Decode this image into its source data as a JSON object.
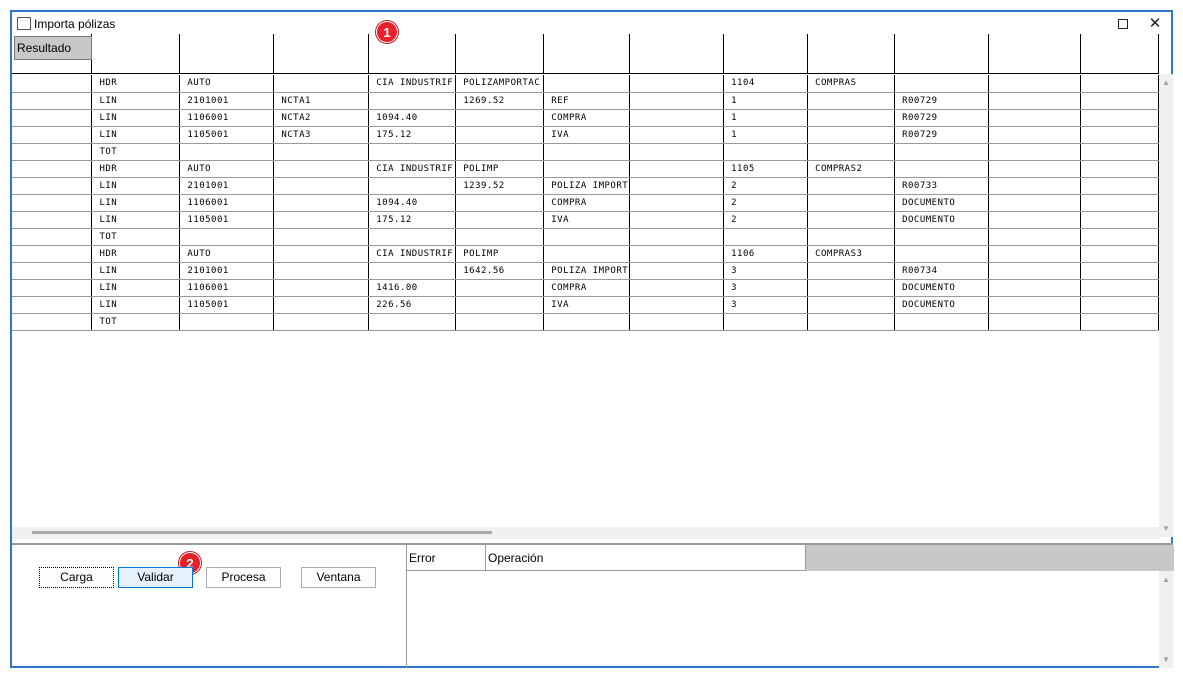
{
  "window": {
    "title": "Importa pólizas",
    "maximize_glyph": "□",
    "close_glyph": "✕"
  },
  "annotations": {
    "badge1": "1",
    "badge2": "2"
  },
  "grid": {
    "header_label": "Resultado",
    "columns": 12,
    "rows": [
      [
        "",
        "HDR",
        "AUTO",
        "",
        "CIA INDUSTRIF",
        "POLIZAMPORTAC",
        "",
        "",
        "1104",
        "COMPRAS",
        "",
        "",
        ""
      ],
      [
        "",
        "LIN",
        "2101001",
        "NCTA1",
        "",
        "1269.52",
        "REF",
        "",
        "1",
        "",
        "R00729",
        "",
        ""
      ],
      [
        "",
        "LIN",
        "1106001",
        "NCTA2",
        "1094.40",
        "",
        "COMPRA",
        "",
        "1",
        "",
        "R00729",
        "",
        ""
      ],
      [
        "",
        "LIN",
        "1105001",
        "NCTA3",
        "175.12",
        "",
        "IVA",
        "",
        "1",
        "",
        "R00729",
        "",
        ""
      ],
      [
        "",
        "TOT",
        "",
        "",
        "",
        "",
        "",
        "",
        "",
        "",
        "",
        "",
        ""
      ],
      [
        "",
        "HDR",
        "AUTO",
        "",
        "CIA INDUSTRIF",
        "POLIMP",
        "",
        "",
        "1105",
        "COMPRAS2",
        "",
        "",
        ""
      ],
      [
        "",
        "LIN",
        "2101001",
        "",
        "",
        "1239.52",
        "POLIZA IMPORT",
        "",
        "2",
        "",
        "R00733",
        "",
        ""
      ],
      [
        "",
        "LIN",
        "1106001",
        "",
        "1094.40",
        "",
        "COMPRA",
        "",
        "2",
        "",
        "DOCUMENTO",
        "",
        ""
      ],
      [
        "",
        "LIN",
        "1105001",
        "",
        "175.12",
        "",
        "IVA",
        "",
        "2",
        "",
        "DOCUMENTO",
        "",
        ""
      ],
      [
        "",
        "TOT",
        "",
        "",
        "",
        "",
        "",
        "",
        "",
        "",
        "",
        "",
        ""
      ],
      [
        "",
        "HDR",
        "AUTO",
        "",
        "CIA INDUSTRIF",
        "POLIMP",
        "",
        "",
        "1106",
        "COMPRAS3",
        "",
        "",
        ""
      ],
      [
        "",
        "LIN",
        "2101001",
        "",
        "",
        "1642.56",
        "POLIZA IMPORT",
        "",
        "3",
        "",
        "R00734",
        "",
        ""
      ],
      [
        "",
        "LIN",
        "1106001",
        "",
        "1416.00",
        "",
        "COMPRA",
        "",
        "3",
        "",
        "DOCUMENTO",
        "",
        ""
      ],
      [
        "",
        "LIN",
        "1105001",
        "",
        "226.56",
        "",
        "IVA",
        "",
        "3",
        "",
        "DOCUMENTO",
        "",
        ""
      ],
      [
        "",
        "TOT",
        "",
        "",
        "",
        "",
        "",
        "",
        "",
        "",
        "",
        "",
        ""
      ]
    ]
  },
  "buttons": {
    "carga": "Carga",
    "validar": "Validar",
    "procesa": "Procesa",
    "ventana": "Ventana"
  },
  "errors": {
    "col_error": "Error",
    "col_operacion": "Operación"
  },
  "scroll": {
    "up": "▲",
    "down": "▼"
  }
}
